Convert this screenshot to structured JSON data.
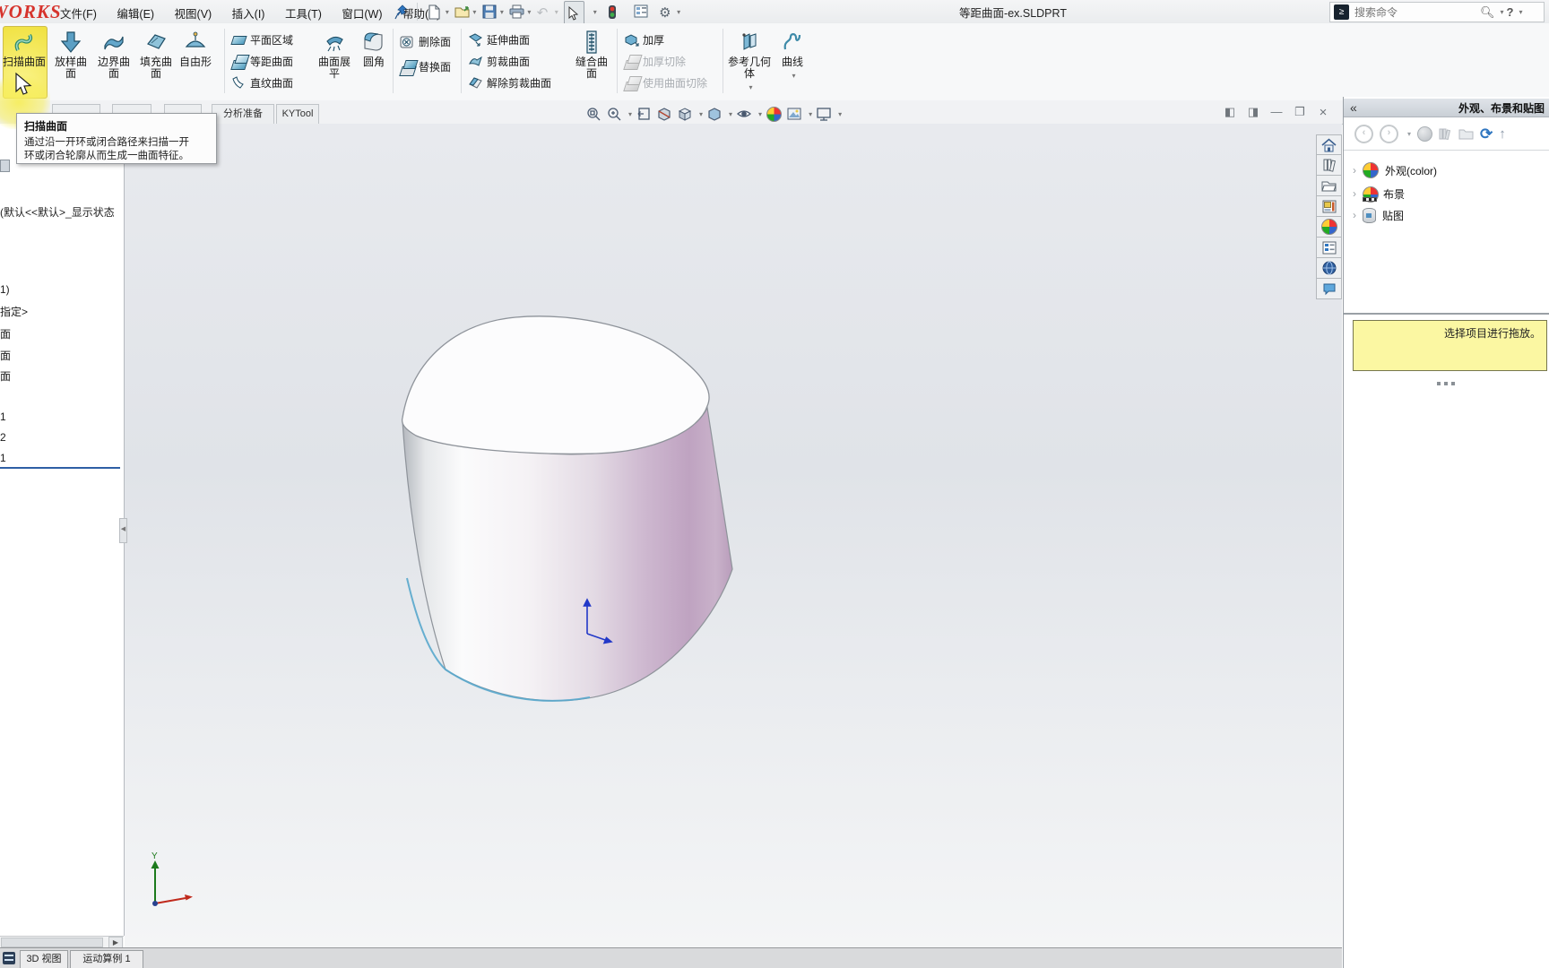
{
  "window": {
    "logo": "WORKS",
    "menus": [
      "文件(F)",
      "编辑(E)",
      "视图(V)",
      "插入(I)",
      "工具(T)",
      "窗口(W)",
      "帮助(H)"
    ],
    "title": "等距曲面-ex.SLDPRT",
    "search_placeholder": "搜索命令",
    "help_label": "?",
    "quickbar_icons": [
      "pin",
      "new-document",
      "open",
      "save",
      "print",
      "undo",
      "select",
      "rebuild",
      "file-properties",
      "options"
    ]
  },
  "ribbon": {
    "sweep": "扫描曲面",
    "loft": "放样曲面",
    "boundary": "边界曲面",
    "fill": "填充曲面",
    "freeform": "自由形",
    "planar": "平面区域",
    "offset": "等距曲面",
    "ruled": "直纹曲面",
    "flatten": "曲面展平",
    "fillet": "圆角",
    "delete_face": "删除面",
    "replace_face": "替换面",
    "extend": "延伸曲面",
    "trim": "剪裁曲面",
    "untrim": "解除剪裁曲面",
    "knit": "缝合曲面",
    "thicken": "加厚",
    "thicken_cut": "加厚切除",
    "cut_with_surface": "使用曲面切除",
    "ref_geometry": "参考几何体",
    "curves": "曲线"
  },
  "tabs": {
    "analysis": "分析准备",
    "kytool": "KYTool"
  },
  "tooltip": {
    "title": "扫描曲面",
    "line1": "通过沿一开环或闭合路径来扫描一开",
    "line2": "环或闭合轮廓从而生成一曲面特征。"
  },
  "feature_tree": {
    "config": "(默认<<默认>_显示状态",
    "items": [
      "1)",
      "指定>",
      "面",
      "面",
      "面",
      "1",
      "2",
      "1"
    ]
  },
  "viewport": {
    "axis_y_label": "Y",
    "headsup_icons": [
      "zoom-fit",
      "zoom-area",
      "previous-view",
      "section-view",
      "view-orientation",
      "display-style",
      "hide-show-items",
      "edit-appearance",
      "apply-scene",
      "view-settings"
    ],
    "window_controls": [
      "pane-left",
      "pane-right",
      "minimize",
      "restore",
      "close"
    ]
  },
  "task_pane": {
    "header": "外观、布景和贴图",
    "collapse_glyph": "«",
    "nav_icons": [
      "back",
      "forward",
      "forward-menu",
      "appearances",
      "design-library",
      "open-file",
      "refresh",
      "up"
    ],
    "tree": [
      "外观(color)",
      "布景",
      "贴图"
    ],
    "message": "选择项目进行拖放。",
    "strip_icons": [
      "home",
      "design-library",
      "file-explorer",
      "view-palette",
      "appearances-scenes",
      "custom-properties",
      "solidworks-forum",
      "chat"
    ]
  },
  "motion_bar": {
    "tabs": [
      "3D 视图",
      "运动算例 1"
    ]
  },
  "colors": {
    "accent_yellow": "#f0e140",
    "model_mauve": "#bfa3c1",
    "rollback_blue": "#2f5fa5",
    "message_yellow": "#fbf7a2",
    "logo_red": "#d6332c"
  }
}
